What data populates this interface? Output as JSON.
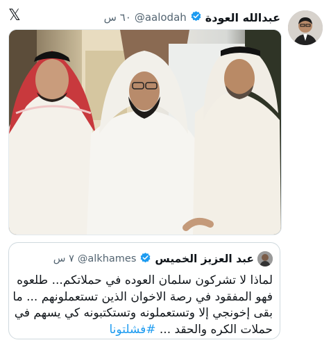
{
  "app": {
    "logo_icon": "x-logo-icon"
  },
  "post": {
    "author_name": "عبدالله العودة",
    "handle": "@aalodah",
    "time": "٦٠ س",
    "verified_color": "#1d9bf0",
    "image_icon": "photo-three-men-icon"
  },
  "quote": {
    "author_name": "عبد العزيز الخميس",
    "handle": "@alkhames",
    "time": "٧ س",
    "text_lines": [
      "لماذا لا تشركون سلمان العوده في حملاتكم... طلعوه",
      "فهو المفقود في رصة الاخوان الذين تستعملونهم ... ما",
      "بقى إخونجي إلا وتستعملونه وتستكتبونه كي يسهم في",
      "حملات الكره والحقد ..."
    ],
    "hashtag": "#فشلتونا",
    "hashtag_color": "#1d9bf0"
  }
}
